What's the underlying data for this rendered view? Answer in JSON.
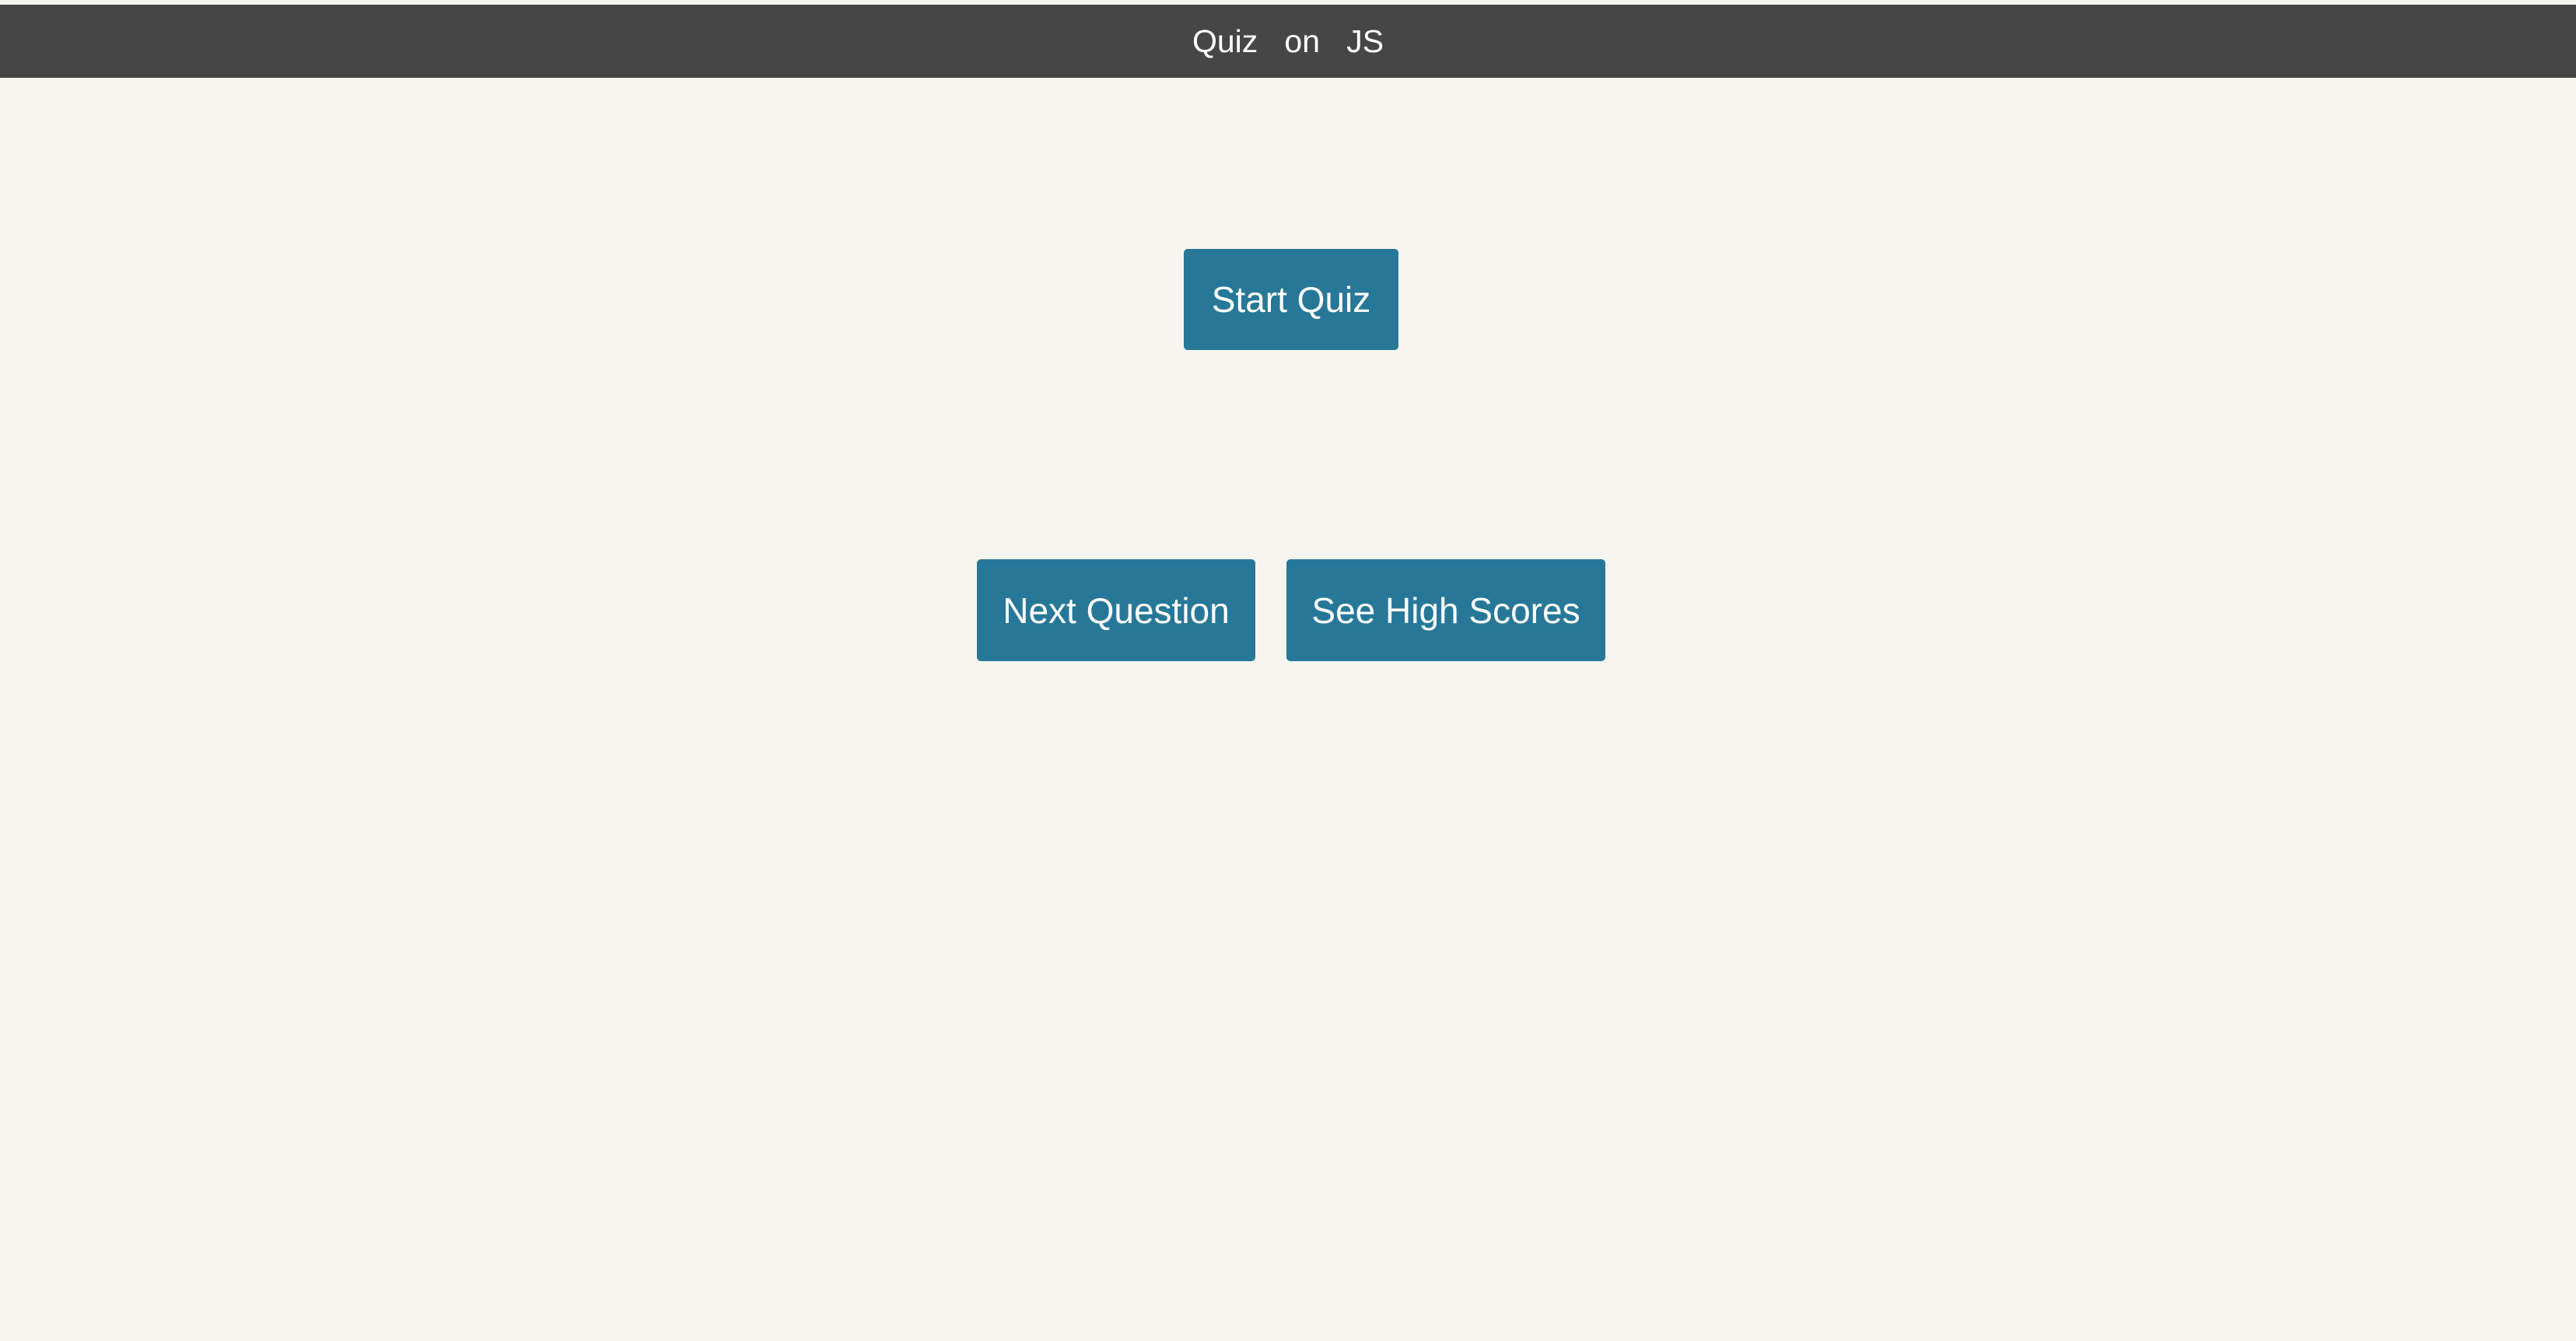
{
  "header": {
    "title": "Quiz   on   JS"
  },
  "buttons": {
    "start_quiz": "Start Quiz",
    "next_question": "Next Question",
    "see_high_scores": "See High Scores"
  },
  "colors": {
    "background": "#f6f5f0",
    "header_bg": "#464646",
    "button_bg": "#277898",
    "button_text": "#ffffff"
  }
}
